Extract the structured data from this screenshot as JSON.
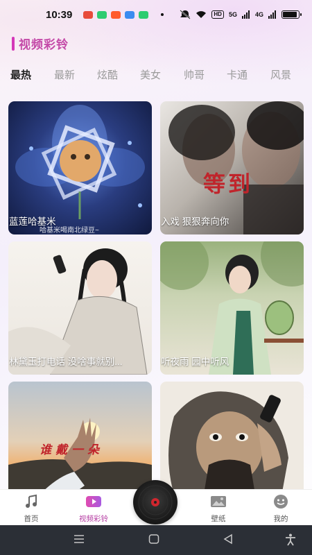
{
  "status_bar": {
    "time": "10:39",
    "hd_label": "HD",
    "signal1": "5G",
    "signal2": "4G",
    "battery_level": 0.9
  },
  "page": {
    "title": "视频彩铃"
  },
  "tabs": [
    {
      "label": "最热",
      "active": true
    },
    {
      "label": "最新",
      "active": false
    },
    {
      "label": "炫酷",
      "active": false
    },
    {
      "label": "美女",
      "active": false
    },
    {
      "label": "帅哥",
      "active": false
    },
    {
      "label": "卡通",
      "active": false
    },
    {
      "label": "风景",
      "active": false
    }
  ],
  "cards": [
    {
      "caption": "蓝莲哈基米",
      "sub": "哈基米喝南北绿豆~"
    },
    {
      "caption": "入戏 狠狠奔向你",
      "art_text": "等到"
    },
    {
      "caption": "林黛玉打电话 没啥事就别..."
    },
    {
      "caption": "听夜雨 园中听风"
    },
    {
      "caption": "",
      "art_text": "谁戴一朵"
    },
    {
      "caption": ""
    }
  ],
  "bottom_nav": {
    "items": [
      {
        "label": "首页",
        "icon": "music-note-icon",
        "active": false
      },
      {
        "label": "视频彩铃",
        "icon": "video-icon",
        "active": true
      },
      {
        "label": "壁纸",
        "icon": "image-icon",
        "active": false
      },
      {
        "label": "我的",
        "icon": "smiley-icon",
        "active": false
      }
    ],
    "center_icon": "vinyl-record-icon"
  },
  "colors": {
    "accent": "#c44aa8",
    "active_tab": "#222222",
    "inactive_tab": "#9a9a9a"
  }
}
